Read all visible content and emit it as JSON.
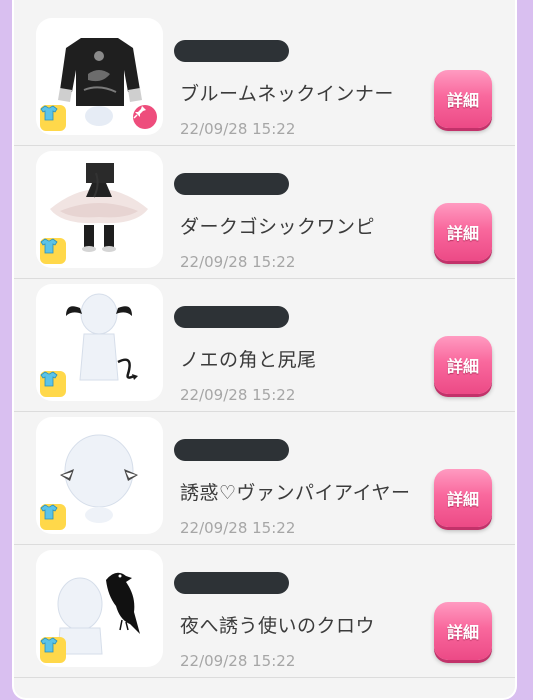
{
  "items": [
    {
      "name": "ブルームネックインナー",
      "date": "22/09/28 15:22",
      "detail_label": "詳細",
      "has_pin": true
    },
    {
      "name": "ダークゴシックワンピ",
      "date": "22/09/28 15:22",
      "detail_label": "詳細",
      "has_pin": false
    },
    {
      "name": "ノエの角と尻尾",
      "date": "22/09/28 15:22",
      "detail_label": "詳細",
      "has_pin": false
    },
    {
      "name": "誘惑♡ヴァンパイアイヤー",
      "date": "22/09/28 15:22",
      "detail_label": "詳細",
      "has_pin": false
    },
    {
      "name": "夜へ誘う使いのクロウ",
      "date": "22/09/28 15:22",
      "detail_label": "詳細",
      "has_pin": false
    }
  ],
  "colors": {
    "background": "#d9bff0",
    "panel": "#f4f4f4",
    "detail_button": "#f9689d",
    "redacted_bar": "#2d3236",
    "category_icon": "#ffd84a"
  },
  "icons": {
    "category": "shirt-category-icon",
    "pin": "pin-icon"
  }
}
